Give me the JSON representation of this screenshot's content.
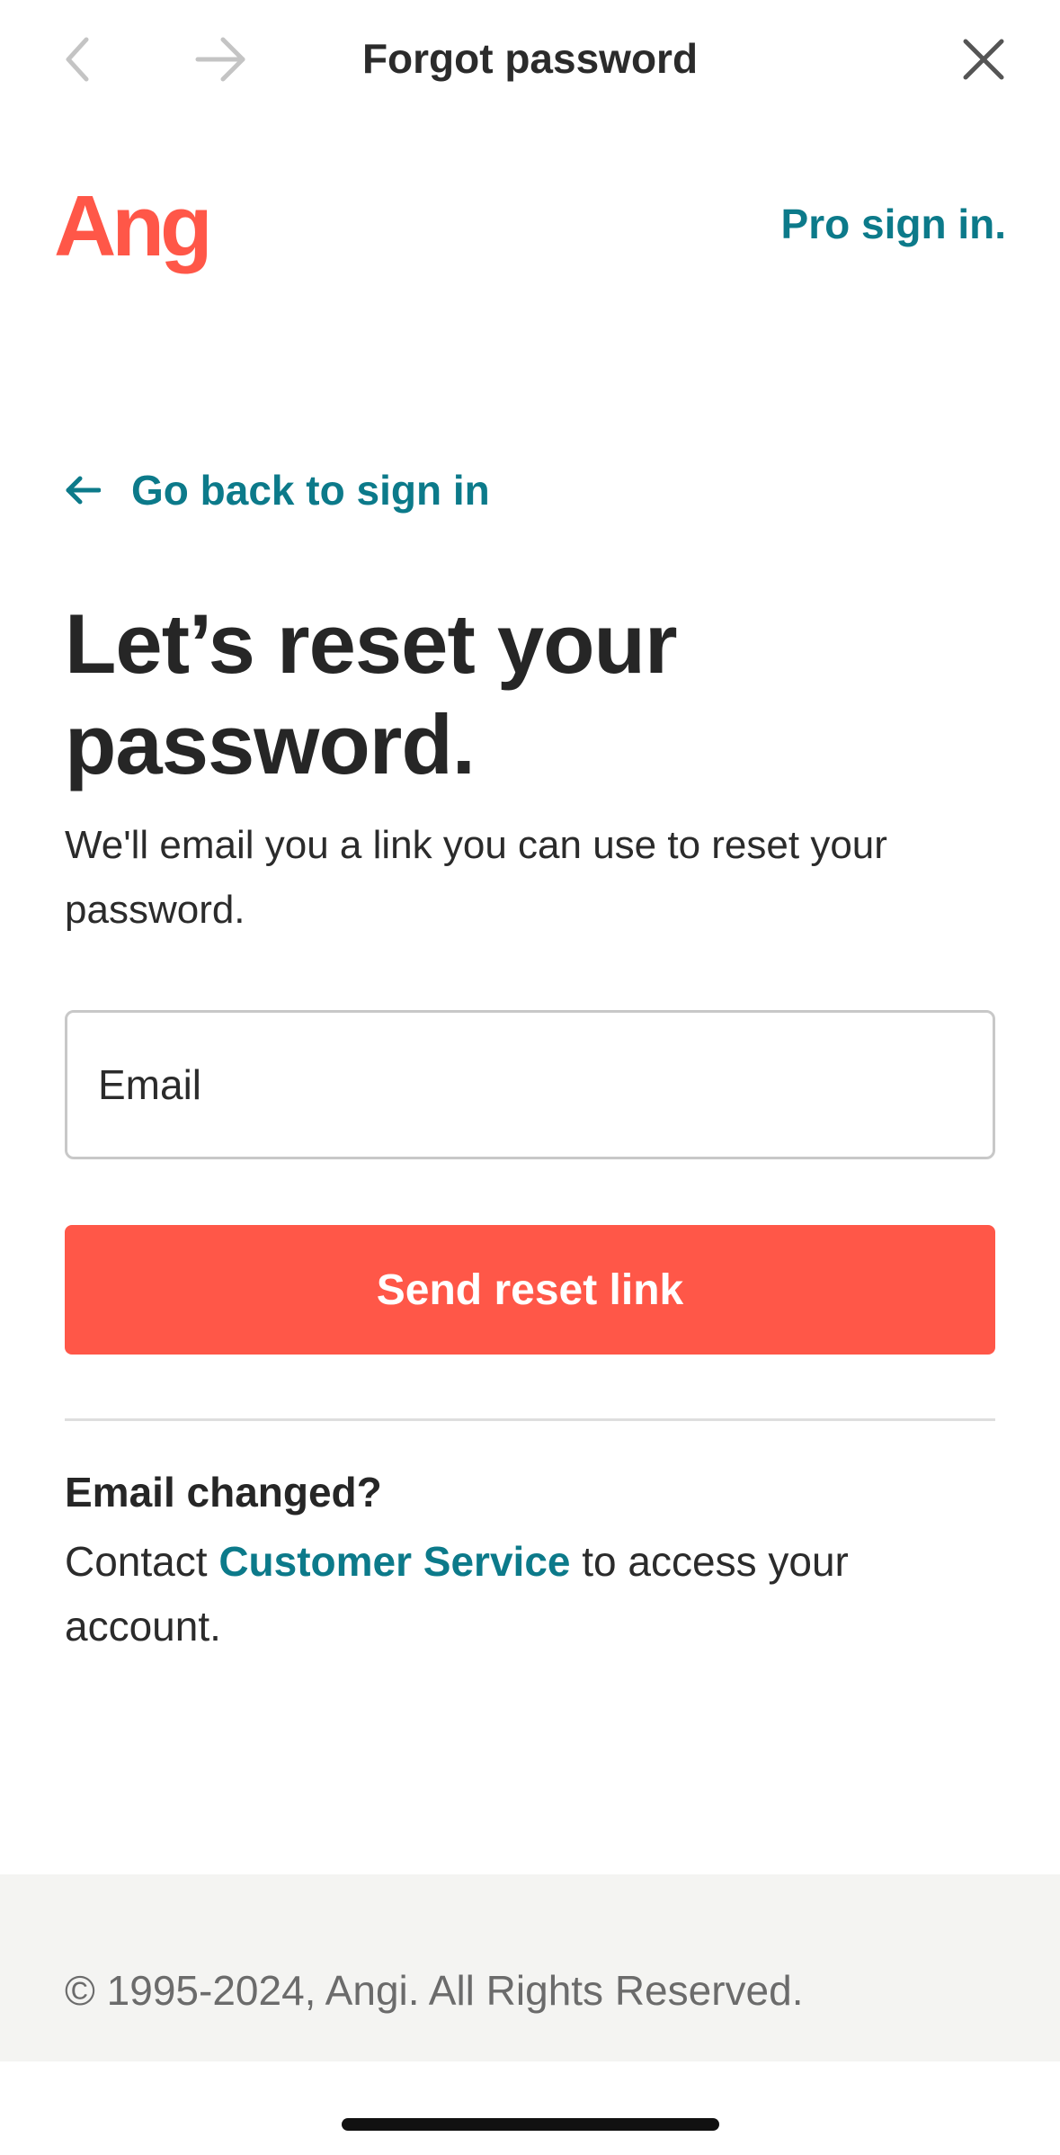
{
  "topbar": {
    "title": "Forgot password",
    "back_icon": "chevron-left-icon",
    "forward_icon": "arrow-right-icon",
    "close_icon": "close-icon"
  },
  "header": {
    "logo_text": "Angi",
    "pro_link": "Pro sign in."
  },
  "main": {
    "back_link": "Go back to sign in",
    "heading": "Let’s reset your password.",
    "subtext": "We'll email you a link you can use to reset your password.",
    "email_placeholder": "Email",
    "send_button": "Send reset link",
    "email_changed_title": "Email changed?",
    "contact_prefix": "Contact ",
    "customer_service_link": "Customer Service",
    "contact_suffix": " to access your account."
  },
  "footer": {
    "copyright": "© 1995-2024, Angi. All Rights Reserved."
  },
  "colors": {
    "accent_teal": "#0c7a8a",
    "brand_coral": "#ff5748",
    "footer_bg": "#f4f4f2"
  }
}
